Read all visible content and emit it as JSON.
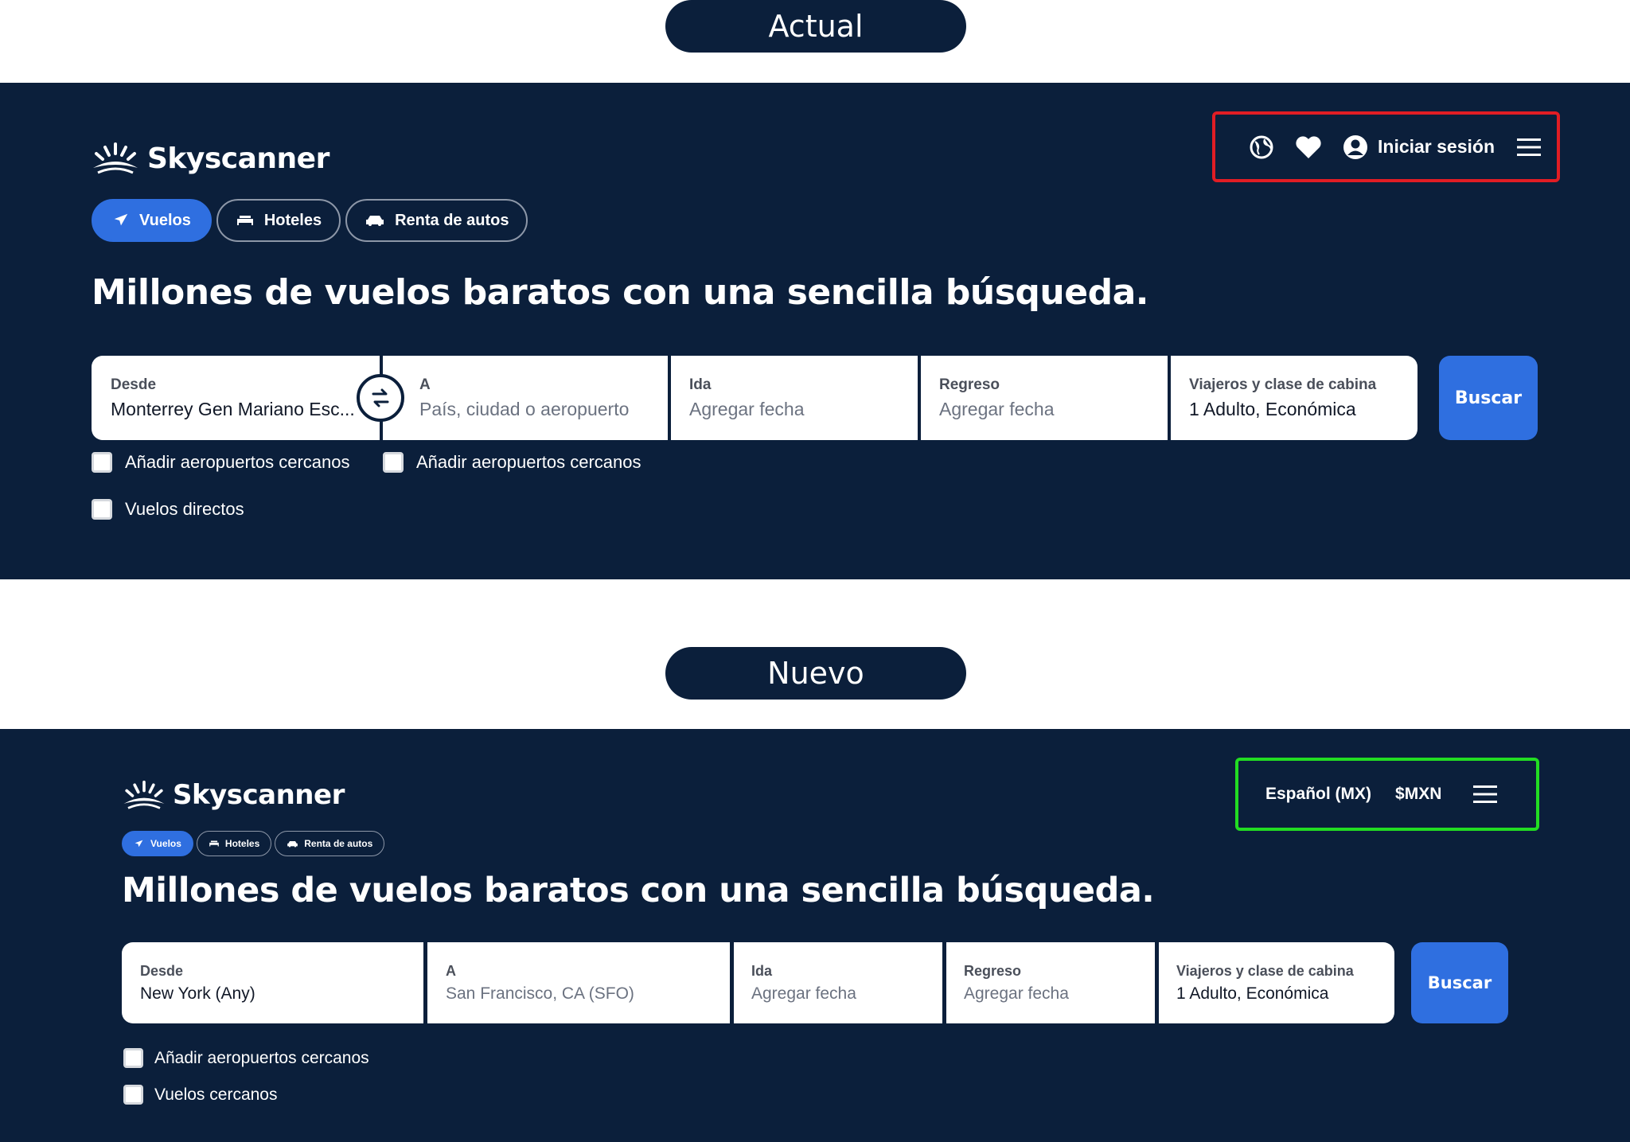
{
  "top_section": {
    "title": "Actual",
    "logo_text": "Skyscanner",
    "tabs": [
      {
        "label": "Vuelos",
        "active": true,
        "icon": "plane-icon"
      },
      {
        "label": "Hoteles",
        "active": false,
        "icon": "bed-icon"
      },
      {
        "label": "Renta de autos",
        "active": false,
        "icon": "car-icon"
      }
    ],
    "header_actions": {
      "icons": [
        "globe-icon",
        "heart-icon",
        "user-icon"
      ],
      "login_label": "Iniciar sesión",
      "menu_icon": "menu-icon",
      "highlight_color": "#e11d24"
    },
    "headline": "Millones de vuelos baratos con una sencilla búsqueda.",
    "search": {
      "from_label": "Desde",
      "from_value": "Monterrey Gen Mariano Esc...",
      "to_label": "A",
      "to_placeholder": "País, ciudad o aeropuerto",
      "depart_label": "Ida",
      "depart_placeholder": "Agregar fecha",
      "return_label": "Regreso",
      "return_placeholder": "Agregar fecha",
      "travelers_label": "Viajeros y clase de cabina",
      "travelers_value": "1 Adulto, Económica",
      "search_button": "Buscar"
    },
    "options": {
      "nearby_from": "Añadir aeropuertos cercanos",
      "nearby_to": "Añadir aeropuertos cercanos",
      "direct": "Vuelos directos"
    }
  },
  "bottom_section": {
    "title": "Nuevo",
    "logo_text": "Skyscanner",
    "tabs": [
      {
        "label": "Vuelos",
        "active": true,
        "icon": "plane-icon"
      },
      {
        "label": "Hoteles",
        "active": false,
        "icon": "bed-icon"
      },
      {
        "label": "Renta de autos",
        "active": false,
        "icon": "car-icon"
      }
    ],
    "header_actions": {
      "language": "Español (MX)",
      "currency": "$MXN",
      "menu_icon": "menu-icon",
      "highlight_color": "#22dd22"
    },
    "headline": "Millones de vuelos baratos con una sencilla búsqueda.",
    "search": {
      "from_label": "Desde",
      "from_value": "New York (Any)",
      "to_label": "A",
      "to_placeholder": "San Francisco, CA (SFO)",
      "depart_label": "Ida",
      "depart_placeholder": "Agregar fecha",
      "return_label": "Regreso",
      "return_placeholder": "Agregar fecha",
      "travelers_label": "Viajeros y clase de cabina",
      "travelers_value": "1 Adulto, Económica",
      "search_button": "Buscar"
    },
    "options": {
      "nearby": "Añadir aeropuertos cercanos",
      "nearby_flights": "Vuelos cercanos"
    }
  },
  "colors": {
    "panel_bg": "#0b1f3b",
    "accent": "#2f6fe0"
  }
}
